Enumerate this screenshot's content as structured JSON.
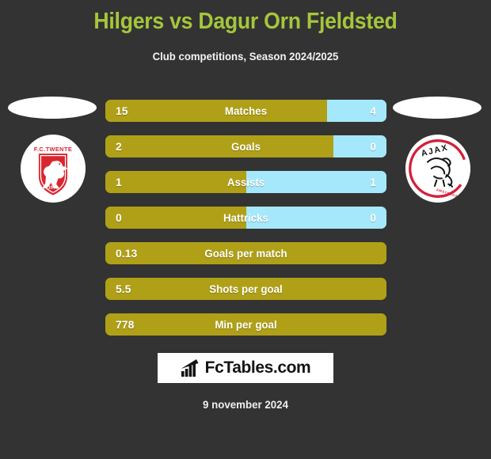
{
  "header": {
    "title": "Hilgers vs Dagur Orn Fjeldsted",
    "subtitle": "Club competitions, Season 2024/2025",
    "title_color": "#A5C63B"
  },
  "home": {
    "club_name": "F.C. TWENTE",
    "club_year": "1965",
    "crest_name": "fc-twente-crest"
  },
  "away": {
    "club_name": "AJAX",
    "club_city": "AMSTERDAM",
    "crest_name": "ajax-crest"
  },
  "footer": {
    "logo_text": "FcTables.com",
    "logo_icon": "bar-chart-icon",
    "date": "9 november 2024"
  },
  "chart_data": {
    "type": "bar",
    "title": "Hilgers vs Dagur Orn Fjeldsted",
    "subtitle": "Club competitions, Season 2024/2025",
    "orientation": "horizontal-diverging",
    "colors": {
      "home": "#B0A017",
      "away": "#A5E8FB",
      "background": "#333333",
      "text": "#ffffff"
    },
    "series": [
      {
        "name": "Hilgers",
        "side": "home"
      },
      {
        "name": "Dagur Orn Fjeldsted",
        "side": "away"
      }
    ],
    "categories": [
      "Matches",
      "Goals",
      "Assists",
      "Hattricks",
      "Goals per match",
      "Shots per goal",
      "Min per goal"
    ],
    "rows": [
      {
        "label": "Matches",
        "home": "15",
        "away": "4",
        "home_pct": 79,
        "two_sided": true
      },
      {
        "label": "Goals",
        "home": "2",
        "away": "0",
        "home_pct": 81,
        "two_sided": true
      },
      {
        "label": "Assists",
        "home": "1",
        "away": "1",
        "home_pct": 50,
        "two_sided": true
      },
      {
        "label": "Hattricks",
        "home": "0",
        "away": "0",
        "home_pct": 50,
        "two_sided": true
      },
      {
        "label": "Goals per match",
        "home": "0.13",
        "away": "",
        "home_pct": 100,
        "two_sided": false
      },
      {
        "label": "Shots per goal",
        "home": "5.5",
        "away": "",
        "home_pct": 100,
        "two_sided": false
      },
      {
        "label": "Min per goal",
        "home": "778",
        "away": "",
        "home_pct": 100,
        "two_sided": false
      }
    ]
  }
}
